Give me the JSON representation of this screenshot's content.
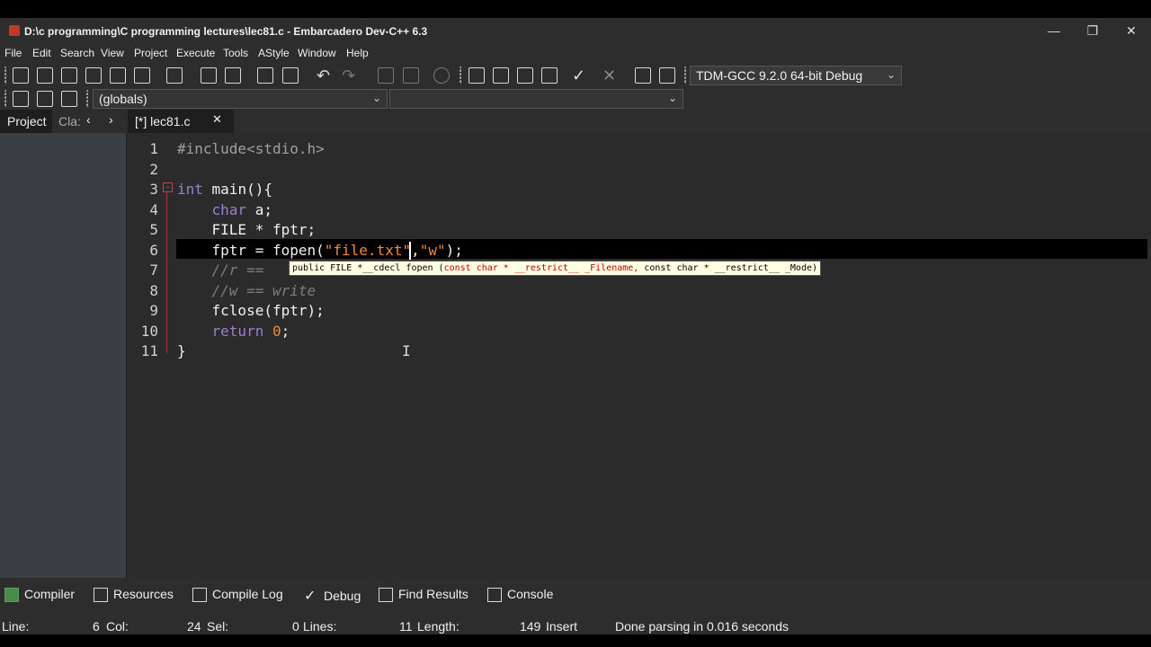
{
  "window": {
    "title": "D:\\c programming\\C programming lectures\\lec81.c - Embarcadero Dev-C++ 6.3",
    "minimize": "—",
    "maximize": "❐",
    "close": "✕"
  },
  "menu": [
    "File",
    "Edit",
    "Search",
    "View",
    "Project",
    "Execute",
    "Tools",
    "AStyle",
    "Window",
    "Help"
  ],
  "toolbar": {
    "compiler_select": "TDM-GCC 9.2.0 64-bit Debug",
    "scope_select": "(globals)",
    "function_select": ""
  },
  "left_tabs": [
    "Project",
    "Cla:"
  ],
  "nav": {
    "prev": "‹",
    "next": "›"
  },
  "file_tab": {
    "label": "[*] lec81.c",
    "close": "✕"
  },
  "editor": {
    "line_numbers": [
      "1",
      "2",
      "3",
      "4",
      "5",
      "6",
      "7",
      "8",
      "9",
      "10",
      "11"
    ],
    "lines": {
      "l1": "#include<stdio.h>",
      "l3a": "int",
      "l3b": " main(){",
      "l4a": "    char",
      "l4b": " a;",
      "l5": "    FILE * fptr;",
      "l6a": "    fptr = fopen(",
      "l6b": "\"file.txt\"",
      "l6c": ",",
      "l6d": "\"w\"",
      "l6e": ");",
      "l7": "    //r ==",
      "l8": "    //w == write",
      "l9": "    fclose(fptr);",
      "l10a": "    return ",
      "l10b": "0",
      "l10c": ";",
      "l11": "}"
    },
    "tooltip": {
      "prefix": "public FILE *__cdecl fopen (",
      "params": "const char * __restrict__ _Filename,",
      "rest": " const char * __restrict__ _Mode)"
    }
  },
  "bottom_tabs": [
    "Compiler",
    "Resources",
    "Compile Log",
    "Debug",
    "Find Results",
    "Console"
  ],
  "status": {
    "line_label": "Line:",
    "line_value": "6",
    "col_label": "Col:",
    "col_value": "24",
    "sel_label": "Sel:",
    "sel_value": "0",
    "lines_label": "Lines:",
    "lines_value": "11",
    "length_label": "Length:",
    "length_value": "149",
    "mode": "Insert",
    "message": "Done parsing in 0.016 seconds"
  }
}
